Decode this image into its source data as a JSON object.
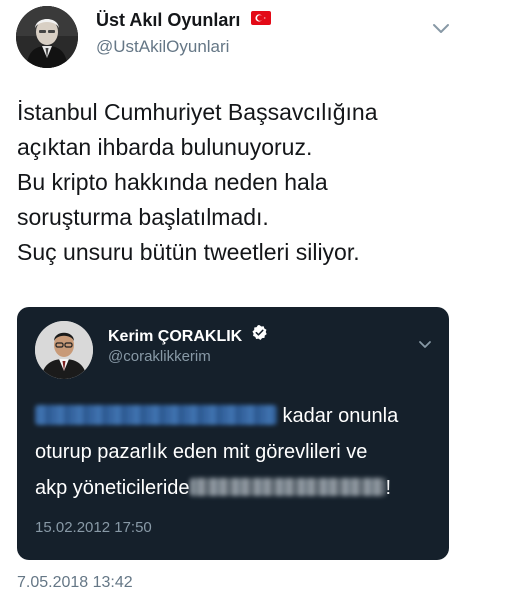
{
  "tweet": {
    "display_name": "Üst Akıl Oyunları",
    "flag_icon": "turkey-flag-icon",
    "handle": "@UstAkilOyunlari",
    "menu_icon": "chevron-down-icon",
    "text_lines": [
      "İstanbul Cumhuriyet Başsavcılığına",
      "açıktan ihbarda bulunuyoruz.",
      "Bu kripto hakkında neden hala",
      "soruşturma başlatılmadı.",
      "Suç unsuru bütün tweetleri siliyor."
    ],
    "timestamp": "7.05.2018 13:42"
  },
  "quoted_tweet": {
    "display_name": "Kerim ÇORAKLIK",
    "verified_icon": "verified-badge-icon",
    "handle": "@coraklikkerim",
    "menu_icon": "chevron-down-icon",
    "line1_suffix": " kadar onunla",
    "line2": "oturup pazarlık eden mit görevlileri ve",
    "line3_prefix": "akp yöneticileride",
    "line3_suffix": "!",
    "date": "15.02.2012 17:50",
    "background_color": "#15202b"
  },
  "colors": {
    "primary_text": "#141619",
    "secondary_text": "#657786",
    "quote_secondary_text": "#8899a6",
    "verified_badge": "#ffffff"
  }
}
